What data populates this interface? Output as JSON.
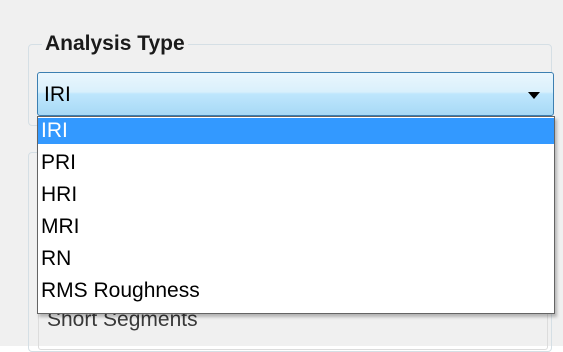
{
  "analysis_group": {
    "title": "Analysis Type"
  },
  "combo": {
    "selected_value": "IRI",
    "icon": "chevron-down-icon"
  },
  "dropdown": {
    "options": [
      "IRI",
      "PRI",
      "HRI",
      "MRI",
      "RN",
      "RMS Roughness"
    ],
    "highlighted_index": 0,
    "highlight_color": "#3399ff"
  },
  "segments": {
    "label": "Short Segments"
  },
  "colors": {
    "combo_border": "#3c7fb1",
    "window_bg": "#f0f0f0"
  }
}
